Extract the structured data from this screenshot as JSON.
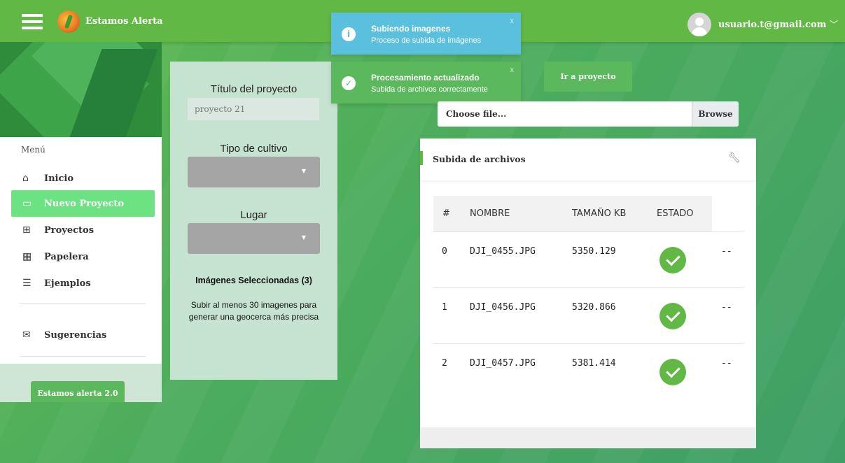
{
  "app": {
    "title": "Estamos Alerta"
  },
  "user": {
    "email": "usuario.t@gmail.com"
  },
  "sidebar": {
    "menu_label": "Menú",
    "items": [
      {
        "label": "Inicio",
        "icon": "home-icon",
        "glyph": "⌂"
      },
      {
        "label": "Nuevo Proyecto",
        "icon": "new-project-icon",
        "glyph": "▭",
        "active": true
      },
      {
        "label": "Proyectos",
        "icon": "grid-icon",
        "glyph": "⊞"
      },
      {
        "label": "Papelera",
        "icon": "trash-grid-icon",
        "glyph": "▦"
      },
      {
        "label": "Ejemplos",
        "icon": "list-icon",
        "glyph": "☰"
      },
      {
        "label": "Sugerencias",
        "icon": "mail-icon",
        "glyph": "✉"
      }
    ],
    "footer_button": "Estamos alerta 2.0"
  },
  "form": {
    "title_label": "Título del proyecto",
    "title_value": "proyecto 21",
    "crop_label": "Tipo de cultivo",
    "place_label": "Lugar",
    "selected_images": "Imágenes Seleccionadas (3)",
    "help_text": "Subir al menos 30 imagenes para generar una geocerca más precisa"
  },
  "toasts": [
    {
      "type": "info",
      "title": "Subiendo imagenes",
      "message": "Proceso de subida de imágenes",
      "close": "x"
    },
    {
      "type": "success",
      "title": "Procesamiento actualizado",
      "message": "Subida de archivos correctamente",
      "close": "x"
    }
  ],
  "goto_button": "Ir a proyecto",
  "file_input": {
    "placeholder": "Choose file...",
    "browse": "Browse"
  },
  "uploads": {
    "title": "Subida de archivos",
    "columns": [
      "#",
      "NOMBRE",
      "TAMAÑO KB",
      "ESTADO"
    ],
    "rows": [
      {
        "idx": "0",
        "name": "DJI_0455.JPG",
        "size": "5350.129",
        "status": "ok",
        "extra": "--"
      },
      {
        "idx": "1",
        "name": "DJI_0456.JPG",
        "size": "5320.866",
        "status": "ok",
        "extra": "--"
      },
      {
        "idx": "2",
        "name": "DJI_0457.JPG",
        "size": "5381.414",
        "status": "ok",
        "extra": "--"
      }
    ]
  },
  "colors": {
    "topbar": "#62b844",
    "active_menu": "#6ce283",
    "info": "#5bc0de",
    "success": "#5cb85c"
  }
}
